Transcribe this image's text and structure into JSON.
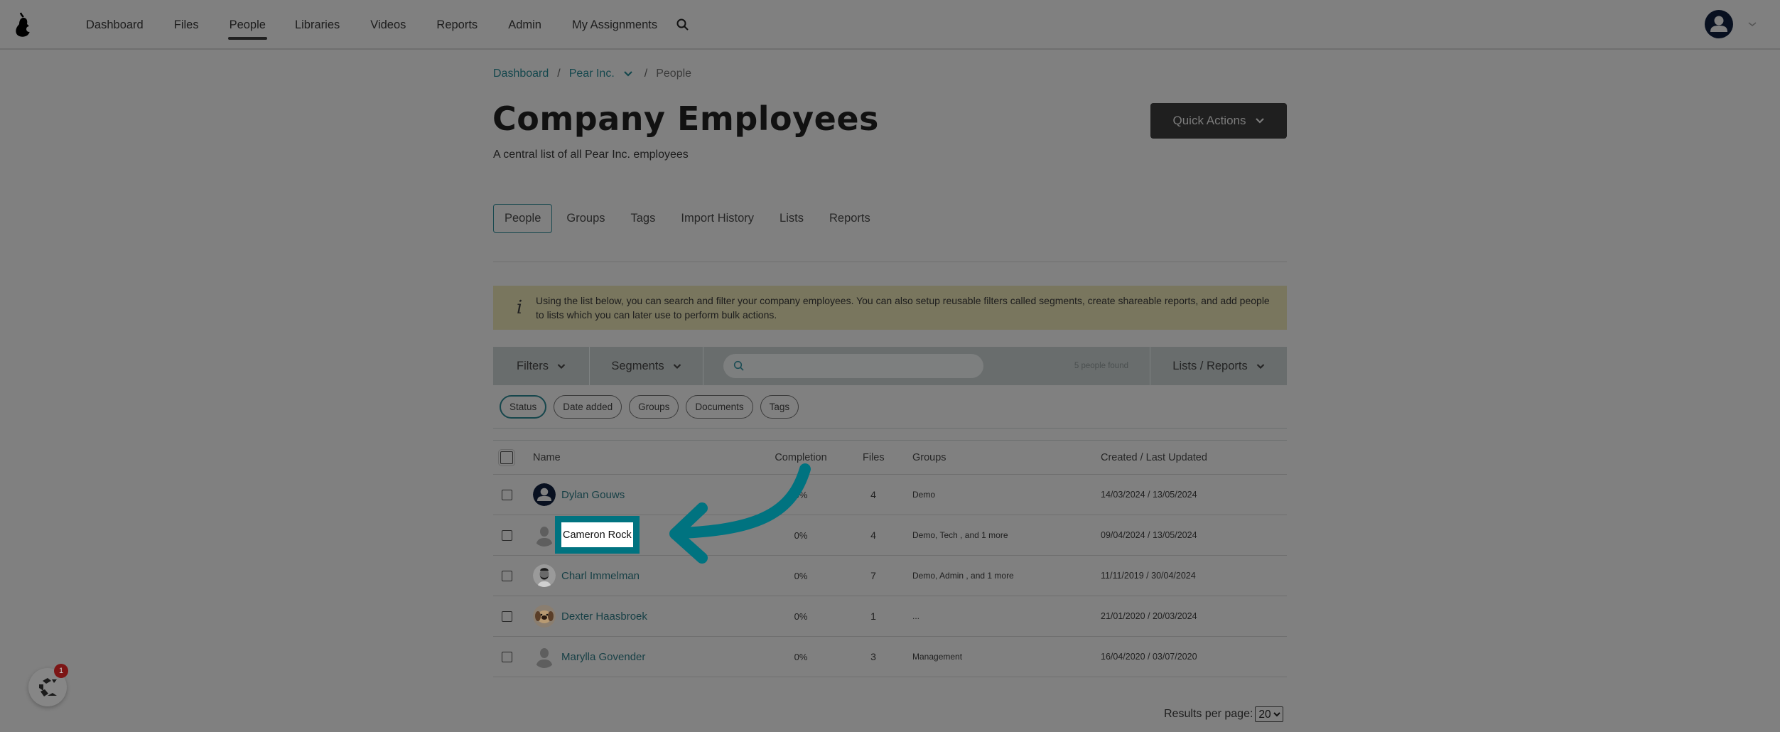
{
  "nav": {
    "items": [
      {
        "label": "Dashboard",
        "active": false
      },
      {
        "label": "Files",
        "active": false
      },
      {
        "label": "People",
        "active": true
      },
      {
        "label": "Libraries",
        "active": false
      },
      {
        "label": "Videos",
        "active": false
      },
      {
        "label": "Reports",
        "active": false
      },
      {
        "label": "Admin",
        "active": false
      },
      {
        "label": "My Assignments",
        "active": false
      }
    ],
    "search_icon": "search-icon",
    "user_icon": "user-avatar-icon"
  },
  "breadcrumb": {
    "dashboard": "Dashboard",
    "company": "Pear Inc.",
    "current": "People",
    "separator": "/"
  },
  "header": {
    "title": "Company Employees",
    "subtitle": "A central list of all Pear Inc. employees",
    "quick_actions": "Quick Actions"
  },
  "tabs": [
    {
      "label": "People",
      "active": true
    },
    {
      "label": "Groups",
      "active": false
    },
    {
      "label": "Tags",
      "active": false
    },
    {
      "label": "Import History",
      "active": false
    },
    {
      "label": "Lists",
      "active": false
    },
    {
      "label": "Reports",
      "active": false
    }
  ],
  "banner": {
    "icon": "i",
    "text": "Using the list below, you can search and filter your company employees. You can also setup reusable filters called segments, create shareable reports, and add people to lists which you can later use to perform bulk actions."
  },
  "toolbar": {
    "filters": "Filters",
    "segments": "Segments",
    "search_value": "",
    "search_placeholder": "",
    "found": "5 people found",
    "lists_reports": "Lists / Reports"
  },
  "chips": [
    {
      "label": "Status",
      "active": true
    },
    {
      "label": "Date added",
      "active": false
    },
    {
      "label": "Groups",
      "active": false
    },
    {
      "label": "Documents",
      "active": false
    },
    {
      "label": "Tags",
      "active": false
    }
  ],
  "table": {
    "headers": {
      "name": "Name",
      "completion": "Completion",
      "files": "Files",
      "groups": "Groups",
      "dates": "Created / Last Updated"
    },
    "rows": [
      {
        "name": "Dylan Gouws",
        "completion": "0%",
        "files": "4",
        "groups": "Demo",
        "dates": "14/03/2024 / 13/05/2024",
        "avatar": "default-dark"
      },
      {
        "name": "Cameron Rock",
        "completion": "0%",
        "files": "4",
        "groups": "Demo, Tech , and 1 more",
        "dates": "09/04/2024 / 13/05/2024",
        "avatar": "silhouette"
      },
      {
        "name": "Charl Immelman",
        "completion": "0%",
        "files": "7",
        "groups": "Demo, Admin , and 1 more",
        "dates": "11/11/2019 / 30/04/2024",
        "avatar": "photo"
      },
      {
        "name": "Dexter Haasbroek",
        "completion": "0%",
        "files": "1",
        "groups": "...",
        "dates": "21/01/2020 / 20/03/2024",
        "avatar": "photo-dog"
      },
      {
        "name": "Marylla Govender",
        "completion": "0%",
        "files": "3",
        "groups": "Management",
        "dates": "16/04/2020 / 03/07/2020",
        "avatar": "silhouette"
      }
    ]
  },
  "annotation": {
    "highlight_label": "Cameron Rock",
    "color": "#007380"
  },
  "pagination": {
    "label": "Results per page:",
    "value": "20"
  },
  "widget": {
    "badge": "1"
  }
}
